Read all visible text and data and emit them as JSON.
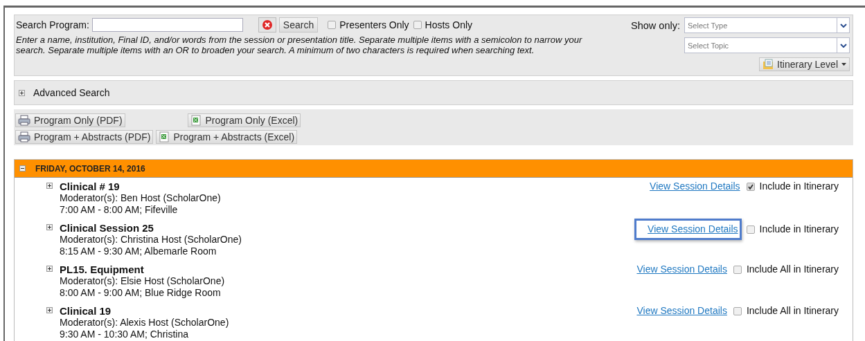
{
  "search": {
    "label": "Search Program:",
    "button": "Search",
    "filters": [
      {
        "label": "Presenters Only",
        "checked": false
      },
      {
        "label": "Hosts Only",
        "checked": false
      }
    ],
    "help": "Enter a name, institution, Final ID, and/or words from the session or presentation title. Separate multiple items with a semicolon to narrow your search. Separate multiple items with an OR to broaden your search. A minimum of two characters is required when searching text."
  },
  "show_only": {
    "label": "Show only:",
    "selects": [
      {
        "placeholder": "Select Type"
      },
      {
        "placeholder": "Select Topic"
      }
    ],
    "itinerary_button": "Itinerary Level"
  },
  "advanced_search": {
    "label": "Advanced Search",
    "expanded": false
  },
  "exports": [
    {
      "label": "Program Only (PDF)",
      "kind": "pdf"
    },
    {
      "label": "Program Only (Excel)",
      "kind": "excel"
    },
    {
      "label": "Program + Abstracts (PDF)",
      "kind": "pdf"
    },
    {
      "label": "Program + Abstracts (Excel)",
      "kind": "excel"
    }
  ],
  "day": {
    "title": "FRIDAY, OCTOBER 14, 2016",
    "expanded": true,
    "sessions": [
      {
        "title": "Clinical # 19",
        "moderators": "Moderator(s): Ben Host (ScholarOne)",
        "time": "7:00 AM - 8:00 AM; Fifeville",
        "link": "View Session Details",
        "include": "Include in Itinerary",
        "checked": true,
        "highlighted": false
      },
      {
        "title": "Clinical Session 25",
        "moderators": "Moderator(s): Christina Host (ScholarOne)",
        "time": "8:15 AM - 9:30 AM; Albemarle Room",
        "link": "View Session Details",
        "include": "Include in Itinerary",
        "checked": false,
        "highlighted": true
      },
      {
        "title": "PL15. Equipment",
        "moderators": "Moderator(s): Elsie Host (ScholarOne)",
        "time": "8:00 AM - 9:00 AM; Blue Ridge Room",
        "link": "View Session Details",
        "include": "Include All in Itinerary",
        "checked": false,
        "highlighted": false
      },
      {
        "title": "Clinical 19",
        "moderators": "Moderator(s): Alexis Host (ScholarOne)",
        "time": "9:30 AM - 10:30 AM; Christina",
        "link": "View Session Details",
        "include": "Include All in Itinerary",
        "checked": false,
        "highlighted": false
      }
    ]
  }
}
